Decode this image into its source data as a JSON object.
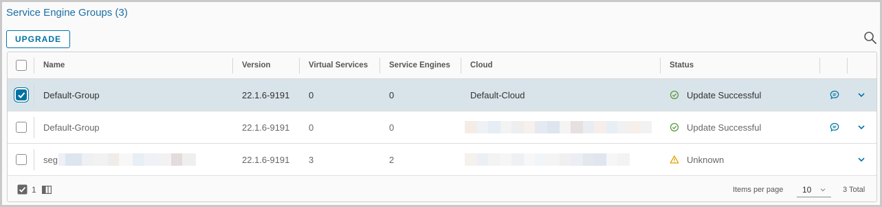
{
  "page": {
    "title": "Service Engine Groups (3)"
  },
  "toolbar": {
    "upgrade_label": "UPGRADE"
  },
  "table": {
    "headers": {
      "name": "Name",
      "version": "Version",
      "virtual_services": "Virtual Services",
      "service_engines": "Service Engines",
      "cloud": "Cloud",
      "status": "Status"
    },
    "rows": [
      {
        "name": "Default-Group",
        "version": "22.1.6-9191",
        "virtual_services": "0",
        "service_engines": "0",
        "cloud": "Default-Cloud",
        "status": "Update Successful",
        "status_icon": "check-circle-icon",
        "selected": true
      },
      {
        "name": "Default-Group",
        "version": "22.1.6-9191",
        "virtual_services": "0",
        "service_engines": "0",
        "cloud": "",
        "status": "Update Successful",
        "status_icon": "check-circle-icon",
        "selected": false
      },
      {
        "name": "seg",
        "version": "22.1.6-9191",
        "virtual_services": "3",
        "service_engines": "2",
        "cloud": "",
        "status": "Unknown",
        "status_icon": "warning-icon",
        "selected": false
      }
    ]
  },
  "footer": {
    "selected_count": "1",
    "items_per_page_label": "Items per page",
    "items_per_page_value": "10",
    "total": "3 Total"
  },
  "colors": {
    "accent": "#0072a3",
    "success": "#5c9a3c",
    "warning": "#e0a500",
    "selected_row": "#d9e4ea"
  }
}
